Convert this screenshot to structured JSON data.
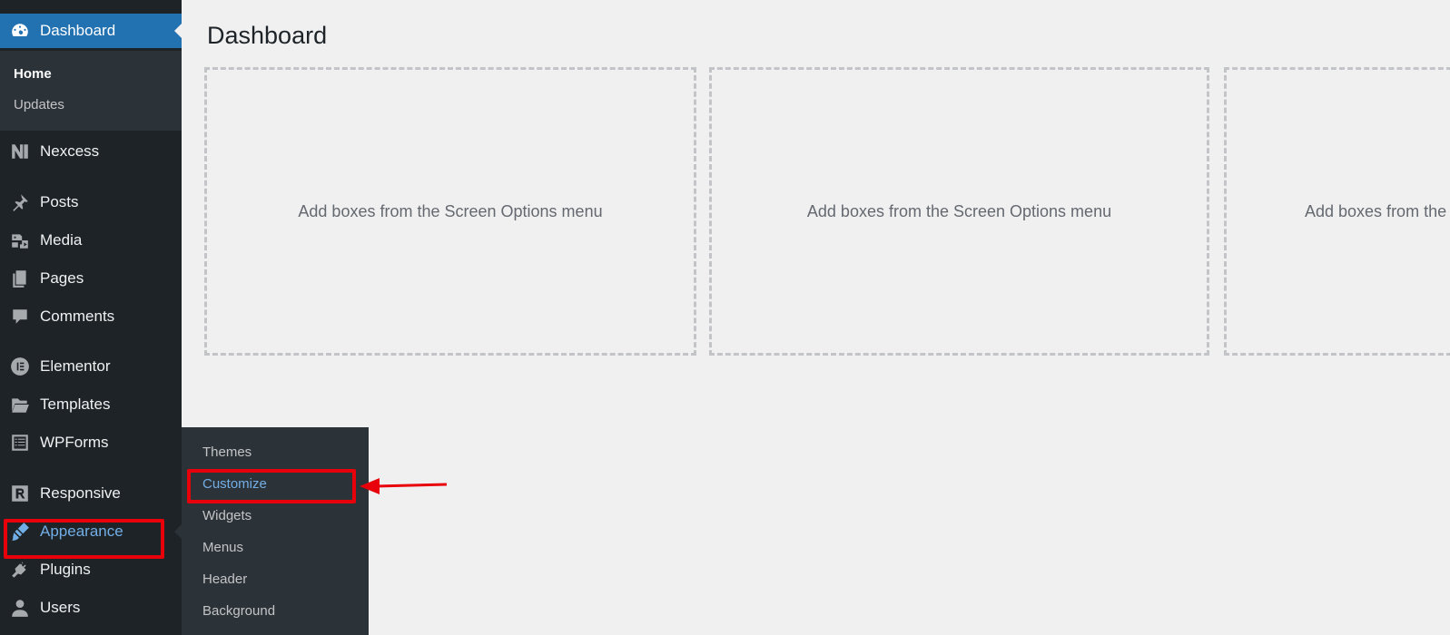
{
  "sidebar": {
    "dashboard": "Dashboard",
    "home": "Home",
    "updates": "Updates",
    "items": [
      {
        "label": "Nexcess",
        "icon": "nexcess-icon"
      },
      {
        "label": "Posts",
        "icon": "pushpin-icon"
      },
      {
        "label": "Media",
        "icon": "media-icon"
      },
      {
        "label": "Pages",
        "icon": "pages-icon"
      },
      {
        "label": "Comments",
        "icon": "comment-icon"
      },
      {
        "label": "Elementor",
        "icon": "elementor-icon"
      },
      {
        "label": "Templates",
        "icon": "folder-icon"
      },
      {
        "label": "WPForms",
        "icon": "wpforms-icon"
      },
      {
        "label": "Responsive",
        "icon": "responsive-icon"
      },
      {
        "label": "Appearance",
        "icon": "paintbrush-icon"
      },
      {
        "label": "Plugins",
        "icon": "plug-icon"
      },
      {
        "label": "Users",
        "icon": "user-icon"
      }
    ]
  },
  "flyout": {
    "items": [
      "Themes",
      "Customize",
      "Widgets",
      "Menus",
      "Header",
      "Background"
    ]
  },
  "main": {
    "title": "Dashboard",
    "boxes": [
      "Add boxes from the Screen Options menu",
      "Add boxes from the Screen Options menu",
      "Add boxes from the Screen Options menu"
    ]
  },
  "colors": {
    "sidebar_bg": "#1d2327",
    "submenu_bg": "#2c3338",
    "accent": "#2271b1",
    "link_active": "#72aee6",
    "highlight": "#e8000b"
  }
}
